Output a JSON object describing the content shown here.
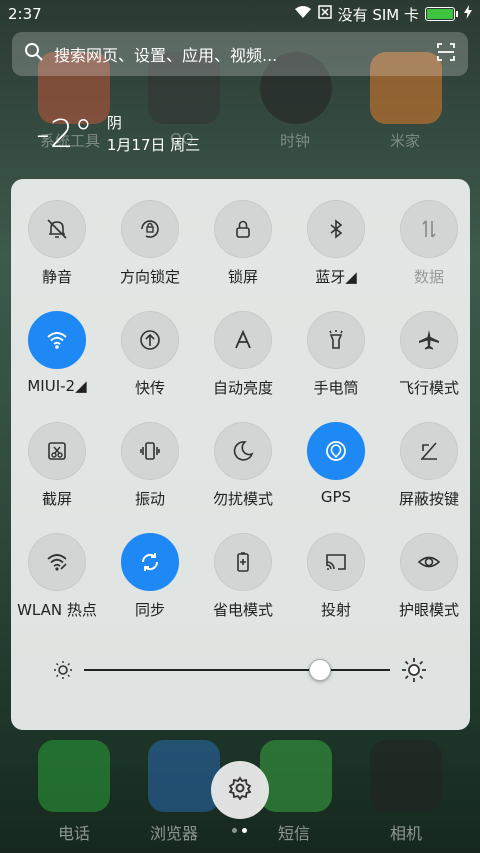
{
  "status": {
    "time": "2:37",
    "sim_text": "没有 SIM 卡",
    "icons": [
      "wifi-icon",
      "sim-icon",
      "battery-icon",
      "charging-icon"
    ]
  },
  "search": {
    "placeholder": "搜索网页、设置、应用、视频..."
  },
  "weather": {
    "temp": "-2°",
    "condition": "阴",
    "date": "1月17日 周三"
  },
  "background_apps": [
    "系统工具",
    "QQ",
    "时钟",
    "米家"
  ],
  "tiles": [
    {
      "label": "静音",
      "icon": "bell-off-icon",
      "on": false
    },
    {
      "label": "方向锁定",
      "icon": "rotation-lock-icon",
      "on": false
    },
    {
      "label": "锁屏",
      "icon": "lock-icon",
      "on": false
    },
    {
      "label": "蓝牙",
      "icon": "bluetooth-icon",
      "on": false
    },
    {
      "label": "数据",
      "icon": "data-icon",
      "on": false
    },
    {
      "label": "MIUI-2",
      "icon": "wifi-icon",
      "on": true
    },
    {
      "label": "快传",
      "icon": "quick-transfer-icon",
      "on": false
    },
    {
      "label": "自动亮度",
      "icon": "auto-brightness-icon",
      "on": false
    },
    {
      "label": "手电筒",
      "icon": "flashlight-icon",
      "on": false
    },
    {
      "label": "飞行模式",
      "icon": "airplane-icon",
      "on": false
    },
    {
      "label": "截屏",
      "icon": "screenshot-icon",
      "on": false
    },
    {
      "label": "振动",
      "icon": "vibrate-icon",
      "on": false
    },
    {
      "label": "勿扰模式",
      "icon": "moon-icon",
      "on": false
    },
    {
      "label": "GPS",
      "icon": "gps-icon",
      "on": true
    },
    {
      "label": "屏蔽按键",
      "icon": "block-keys-icon",
      "on": false
    },
    {
      "label": "WLAN 热点",
      "icon": "hotspot-icon",
      "on": false
    },
    {
      "label": "同步",
      "icon": "sync-icon",
      "on": true
    },
    {
      "label": "省电模式",
      "icon": "battery-saver-icon",
      "on": false
    },
    {
      "label": "投射",
      "icon": "cast-icon",
      "on": false
    },
    {
      "label": "护眼模式",
      "icon": "eye-icon",
      "on": false
    }
  ],
  "brightness": {
    "level": 0.77
  },
  "dock": {
    "labels": [
      "电话",
      "浏览器",
      "短信",
      "相机"
    ]
  },
  "colors": {
    "accent": "#1e88f5",
    "panel": "#f0f2f1"
  }
}
